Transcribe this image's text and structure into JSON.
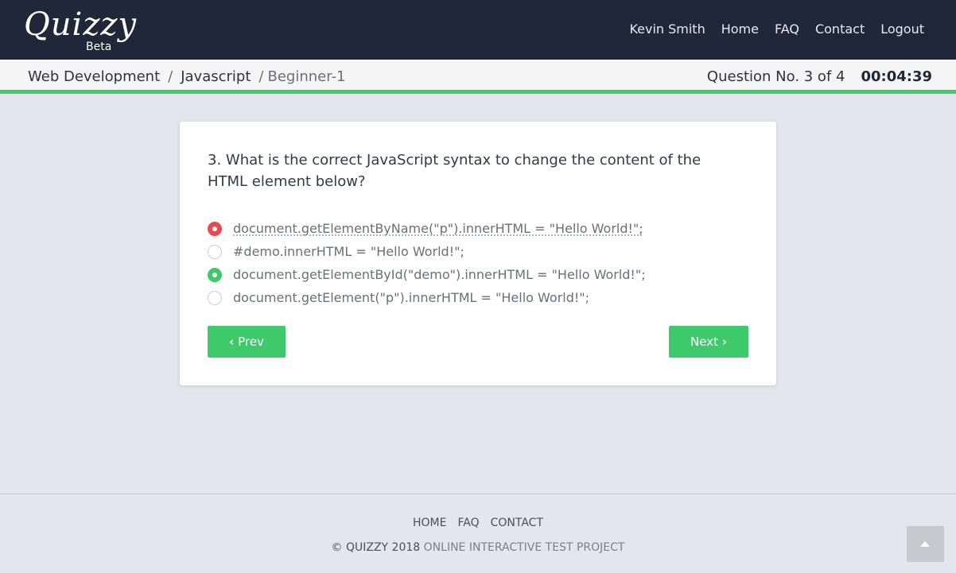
{
  "brand": {
    "name": "Quizzy",
    "tag": "Beta"
  },
  "nav": {
    "user": "Kevin Smith",
    "links": [
      "Home",
      "FAQ",
      "Contact",
      "Logout"
    ]
  },
  "breadcrumb": {
    "items": [
      "Web Development",
      "Javascript",
      "Beginner-1"
    ],
    "separator": "/"
  },
  "status": {
    "question_counter": "Question No. 3 of 4",
    "timer": "00:04:39"
  },
  "question": {
    "text": "3. What is the correct JavaScript syntax to change the content of the HTML element below?",
    "options": [
      {
        "text": "document.getElementByName(\"p\").innerHTML = \"Hello World!\";",
        "state": "wrong"
      },
      {
        "text": "#demo.innerHTML = \"Hello World!\";",
        "state": "none"
      },
      {
        "text": "document.getElementById(\"demo\").innerHTML = \"Hello World!\";",
        "state": "correct"
      },
      {
        "text": "document.getElement(\"p\").innerHTML = \"Hello World!\";",
        "state": "none"
      }
    ]
  },
  "buttons": {
    "prev": "Prev",
    "next": "Next"
  },
  "footer": {
    "links": [
      "HOME",
      "FAQ",
      "CONTACT"
    ],
    "copyright": "© QUIZZY 2018",
    "tagline": "ONLINE INTERACTIVE TEST PROJECT"
  },
  "colors": {
    "navbar": "#1f2839",
    "accent_green": "#3ec96a",
    "wrong_red": "#e84a4f",
    "page_bg": "#e3e6ed"
  },
  "icons": {
    "prev": "chevron-left-icon",
    "next": "chevron-right-icon",
    "scroll_top": "caret-up-icon"
  }
}
